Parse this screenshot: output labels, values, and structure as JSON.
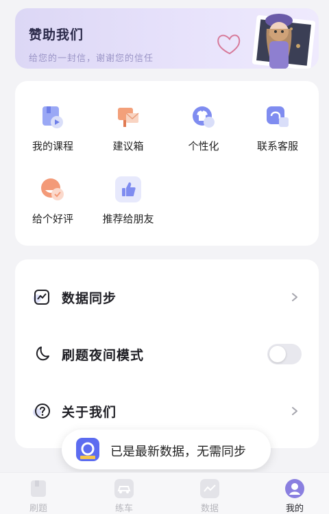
{
  "banner": {
    "title": "赞助我们",
    "subtitle": "给您的一封信，谢谢您的信任"
  },
  "grid": {
    "items": [
      {
        "label": "我的课程",
        "icon": "course-icon"
      },
      {
        "label": "建议箱",
        "icon": "suggestion-box-icon"
      },
      {
        "label": "个性化",
        "icon": "personalize-shirt-icon"
      },
      {
        "label": "联系客服",
        "icon": "customer-service-icon"
      },
      {
        "label": "给个好评",
        "icon": "rating-icon"
      },
      {
        "label": "推荐给朋友",
        "icon": "thumbs-up-icon"
      }
    ]
  },
  "settings": {
    "data_sync": "数据同步",
    "night_mode": "刷题夜间模式",
    "night_mode_on": false,
    "about": "关于我们"
  },
  "toast": {
    "message": "已是最新数据，无需同步"
  },
  "tabbar": {
    "tabs": [
      {
        "label": "刷题",
        "active": false
      },
      {
        "label": "练车",
        "active": false
      },
      {
        "label": "数据",
        "active": false
      },
      {
        "label": "我的",
        "active": true
      }
    ]
  },
  "colors": {
    "accent": "#7b7ff0",
    "background": "#f3f3f6",
    "card": "#ffffff"
  }
}
